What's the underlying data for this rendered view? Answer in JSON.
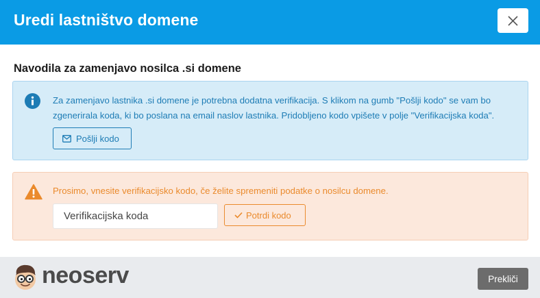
{
  "modal": {
    "title": "Uredi lastništvo domene"
  },
  "content": {
    "section_title": "Navodila za zamenjavo nosilca .si domene",
    "info": {
      "text": "Za zamenjavo lastnika .si domene je potrebna dodatna verifikacija. S klikom na gumb \"Pošlji kodo\" se vam bo zgenerirala koda, ki bo poslana na email naslov lastnika. Pridobljeno kodo vpišete v polje \"Verifikacijska koda\".",
      "send_button_label": "Pošlji kodo",
      "icon": "info-circle-icon"
    },
    "warning": {
      "text": "Prosimo, vnesite verifikacijsko kodo, če želite spremeniti podatke o nosilcu domene.",
      "input_value": "",
      "input_placeholder": "Verifikacijska koda",
      "confirm_button_label": "Potrdi kodo",
      "icon": "warning-triangle-icon"
    }
  },
  "footer": {
    "brand": "neoserv",
    "cancel_label": "Prekliči"
  },
  "colors": {
    "header": "#0a9be5",
    "info_bg": "#d6ecf8",
    "info_text": "#1d7cb5",
    "warning_bg": "#fce8dc",
    "warning_text": "#ea8a2c",
    "footer_bg": "#e9ebee",
    "cancel_button": "#6c6c6c"
  }
}
